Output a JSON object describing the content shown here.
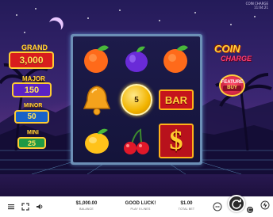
{
  "top_right": {
    "line1": "COIN CHARGE",
    "line2": "11:04:21"
  },
  "jackpots": [
    {
      "name": "GRAND",
      "value": "3,000",
      "color": "#ff2b2b"
    },
    {
      "name": "MAJOR",
      "value": "150",
      "color": "#6a2bd8"
    },
    {
      "name": "MINOR",
      "value": "50",
      "color": "#1f7bd6"
    },
    {
      "name": "MINI",
      "value": "25",
      "color": "#1ea64a"
    }
  ],
  "reels": {
    "symbols": [
      [
        "orange",
        "plum",
        "orange"
      ],
      [
        "bell",
        "coin",
        "bar"
      ],
      [
        "lemon",
        "cherry",
        "dollar"
      ]
    ],
    "coin_value": "5",
    "bar_label": "BAR",
    "dollar_glyph": "$"
  },
  "logo": {
    "line1": "COIN",
    "line2": "CHARGE"
  },
  "feature_buy": {
    "line1": "FEATURE",
    "line2": "BUY"
  },
  "bottom_bar": {
    "balance_value": "$1,000.00",
    "balance_label": "BALANCE",
    "message": "GOOD LUCK!",
    "message_sub": "PLAY 5 LINES",
    "bet_value": "$1.00",
    "bet_label": "TOTAL BET"
  },
  "icons": [
    "menu-icon",
    "fullscreen-icon",
    "sound-icon",
    "bet-settings-icon",
    "spin-icon",
    "autoplay-icon",
    "turbo-icon"
  ]
}
